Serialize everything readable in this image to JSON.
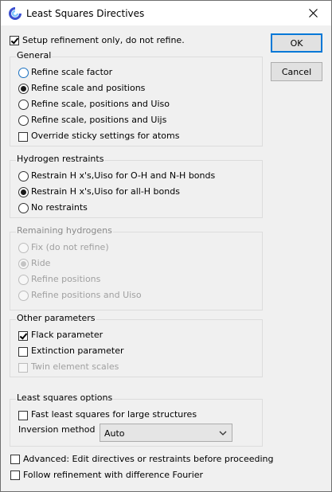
{
  "window": {
    "title": "Least Squares Directives"
  },
  "setup_only": {
    "label": "Setup refinement only, do not refine.",
    "checked": true
  },
  "buttons": {
    "ok": "OK",
    "cancel": "Cancel"
  },
  "general": {
    "title": "General",
    "options": [
      {
        "label": "Refine scale factor",
        "checked": false
      },
      {
        "label": "Refine scale and positions",
        "checked": true
      },
      {
        "label": "Refine scale, positions and Uiso",
        "checked": false
      },
      {
        "label": "Refine scale, positions and Uijs",
        "checked": false
      }
    ],
    "override_sticky": {
      "label": "Override sticky settings for atoms",
      "checked": false
    }
  },
  "hydrogen": {
    "title": "Hydrogen restraints",
    "options": [
      {
        "label": "Restrain H x's,Uiso for O-H and N-H bonds",
        "checked": false
      },
      {
        "label": "Restrain H x's,Uiso for all-H bonds",
        "checked": true
      },
      {
        "label": "No restraints",
        "checked": false
      }
    ]
  },
  "remaining": {
    "title": "Remaining hydrogens",
    "options": [
      {
        "label": "Fix (do not refine)",
        "checked": false
      },
      {
        "label": "Ride",
        "checked": true
      },
      {
        "label": "Refine positions",
        "checked": false
      },
      {
        "label": "Refine positions and Uiso",
        "checked": false
      }
    ]
  },
  "other": {
    "title": "Other parameters",
    "items": [
      {
        "label": "Flack parameter",
        "checked": true
      },
      {
        "label": "Extinction parameter",
        "checked": false
      },
      {
        "label": "Twin element scales",
        "checked": false
      }
    ]
  },
  "lsq": {
    "title": "Least squares options",
    "fast": {
      "label": "Fast least squares for large structures",
      "checked": false
    },
    "inversion_label": "Inversion method",
    "inversion_value": "Auto"
  },
  "advanced": {
    "label": "Advanced: Edit directives or restraints before proceeding",
    "checked": false
  },
  "follow": {
    "label": "Follow refinement with difference Fourier",
    "checked": false
  },
  "colors": {
    "accent": "#0078d7",
    "group_border": "#dcdcdc",
    "background": "#f0f0f0"
  }
}
